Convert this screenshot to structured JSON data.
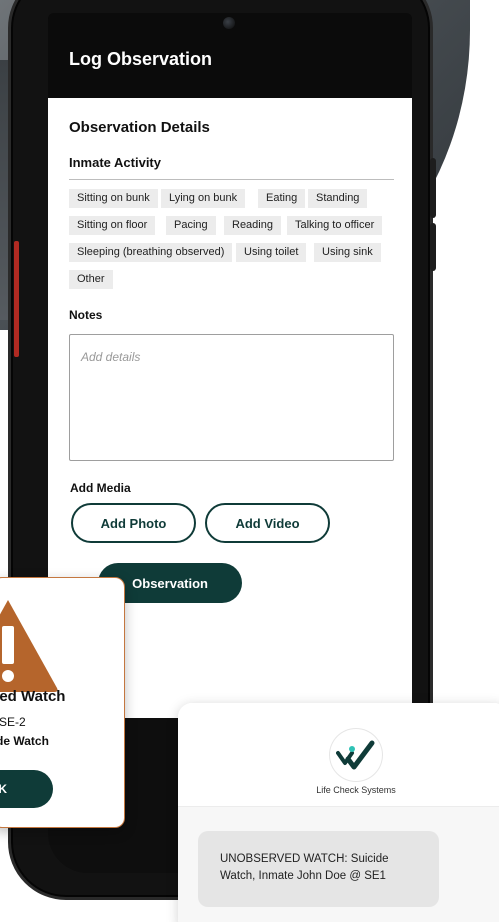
{
  "app": {
    "title": "Log Observation"
  },
  "form": {
    "section_title": "Observation Details",
    "activity_label": "Inmate Activity",
    "activities": [
      "Sitting on bunk",
      "Lying on bunk",
      "Eating",
      "Standing",
      "Sitting on floor",
      "Pacing",
      "Reading",
      "Talking to officer",
      "Sleeping (breathing observed)",
      "Using toilet",
      "Using sink",
      "Other"
    ],
    "notes_label": "Notes",
    "notes_placeholder": "Add details",
    "media_label": "Add Media",
    "add_photo": "Add Photo",
    "add_video": "Add Video",
    "submit_label": "Observation"
  },
  "alert": {
    "title": "ved Watch",
    "line1": "SE-2",
    "line2": "de Watch",
    "ok_label": "OK",
    "icon": "warning-triangle-icon",
    "accent_color": "#b5652c"
  },
  "sms": {
    "brand": "Life Check Systems",
    "message": "UNOBSERVED WATCH: Suicide Watch, Inmate John Doe @ SE1",
    "logo_icon": "checkmark-logo-icon",
    "brand_color": "#0f3b38",
    "accent_color": "#2fc2b5"
  }
}
